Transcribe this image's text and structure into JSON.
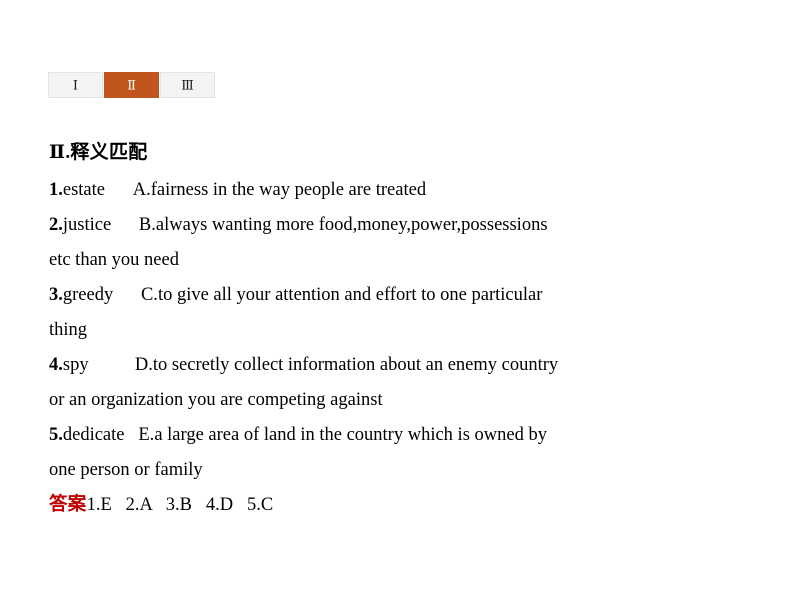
{
  "tabs": [
    {
      "id": "tab-1",
      "label": "Ⅰ",
      "active": false
    },
    {
      "id": "tab-2",
      "label": "Ⅱ",
      "active": true
    },
    {
      "id": "tab-3",
      "label": "Ⅲ",
      "active": false
    }
  ],
  "section": {
    "title": "Ⅱ.释义匹配"
  },
  "items": [
    {
      "num": "1.",
      "term": "estate",
      "gap": "      ",
      "letter": "A.",
      "definition": "fairness in the way people are treated",
      "wrap": ""
    },
    {
      "num": "2.",
      "term": "justice",
      "gap": "      ",
      "letter": "B.",
      "definition": "always wanting more food,money,power,possessions",
      "wrap": "etc than you need"
    },
    {
      "num": "3.",
      "term": "greedy",
      "gap": "      ",
      "letter": "C.",
      "definition": "to give all your attention and effort to one particular",
      "wrap": "thing"
    },
    {
      "num": "4.",
      "term": "spy",
      "gap": "          ",
      "letter": "D.",
      "definition": "to secretly collect information about an enemy country",
      "wrap": "or an organization you are competing against"
    },
    {
      "num": "5.",
      "term": "dedicate",
      "gap": "   ",
      "letter": "E.",
      "definition": "a large area of land in the country which is owned by",
      "wrap": "one person or family"
    }
  ],
  "answer": {
    "label": "答案",
    "values": "1.E   2.A   3.B   4.D   5.C"
  },
  "colors": {
    "active_tab_bg": "#c0561e",
    "inactive_tab_bg": "#f3f3f3",
    "inactive_tab_border": "#e3e3e3",
    "answer_red": "#c00000",
    "text": "#000000",
    "page_bg": "#ffffff"
  }
}
